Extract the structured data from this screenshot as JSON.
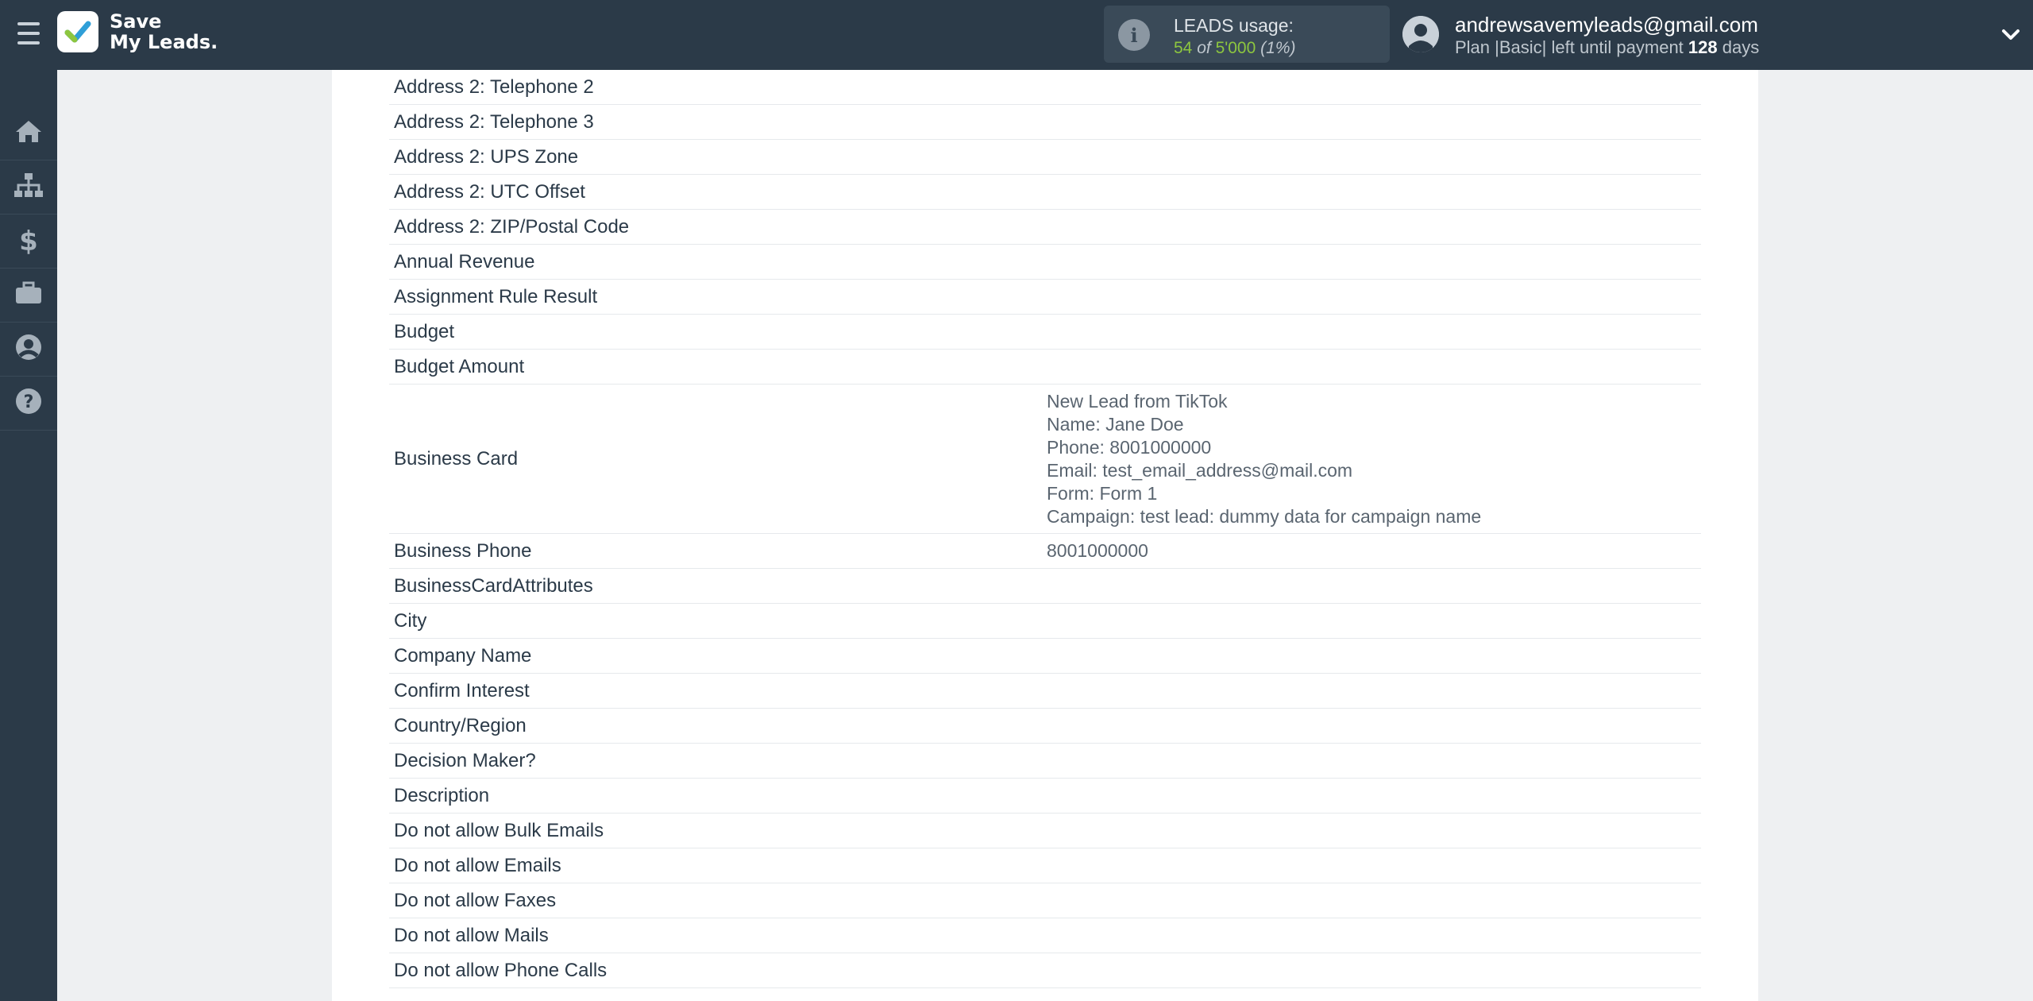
{
  "app": {
    "logo_line1": "Save",
    "logo_line2": "My Leads."
  },
  "usage": {
    "title": "LEADS usage:",
    "used": "54",
    "of": "of",
    "total": "5'000",
    "percent": "(1%)"
  },
  "account": {
    "email": "andrewsavemyleads@gmail.com",
    "plan_prefix": "Plan |",
    "plan_name": "Basic",
    "plan_mid": "| left until payment",
    "days": "128",
    "days_suffix": "days"
  },
  "sidebar": {
    "items": [
      "home-icon",
      "sitemap-icon",
      "dollar-icon",
      "briefcase-icon",
      "user-icon",
      "question-icon"
    ]
  },
  "rows": [
    {
      "field": "Address 2: Telephone 2",
      "value": ""
    },
    {
      "field": "Address 2: Telephone 3",
      "value": ""
    },
    {
      "field": "Address 2: UPS Zone",
      "value": ""
    },
    {
      "field": "Address 2: UTC Offset",
      "value": ""
    },
    {
      "field": "Address 2: ZIP/Postal Code",
      "value": ""
    },
    {
      "field": "Annual Revenue",
      "value": ""
    },
    {
      "field": "Assignment Rule Result",
      "value": ""
    },
    {
      "field": "Budget",
      "value": ""
    },
    {
      "field": "Budget Amount",
      "value": ""
    },
    {
      "field": "Business Card",
      "lines": [
        "New Lead from TikTok",
        "Name: Jane Doe",
        "Phone: 8001000000",
        "Email: test_email_address@mail.com",
        "Form: Form 1",
        "Campaign: test lead: dummy data for campaign name"
      ]
    },
    {
      "field": "Business Phone",
      "value": "8001000000"
    },
    {
      "field": "BusinessCardAttributes",
      "value": ""
    },
    {
      "field": "City",
      "value": ""
    },
    {
      "field": "Company Name",
      "value": ""
    },
    {
      "field": "Confirm Interest",
      "value": ""
    },
    {
      "field": "Country/Region",
      "value": ""
    },
    {
      "field": "Decision Maker?",
      "value": ""
    },
    {
      "field": "Description",
      "value": ""
    },
    {
      "field": "Do not allow Bulk Emails",
      "value": ""
    },
    {
      "field": "Do not allow Emails",
      "value": ""
    },
    {
      "field": "Do not allow Faxes",
      "value": ""
    },
    {
      "field": "Do not allow Mails",
      "value": ""
    },
    {
      "field": "Do not allow Phone Calls",
      "value": ""
    }
  ]
}
